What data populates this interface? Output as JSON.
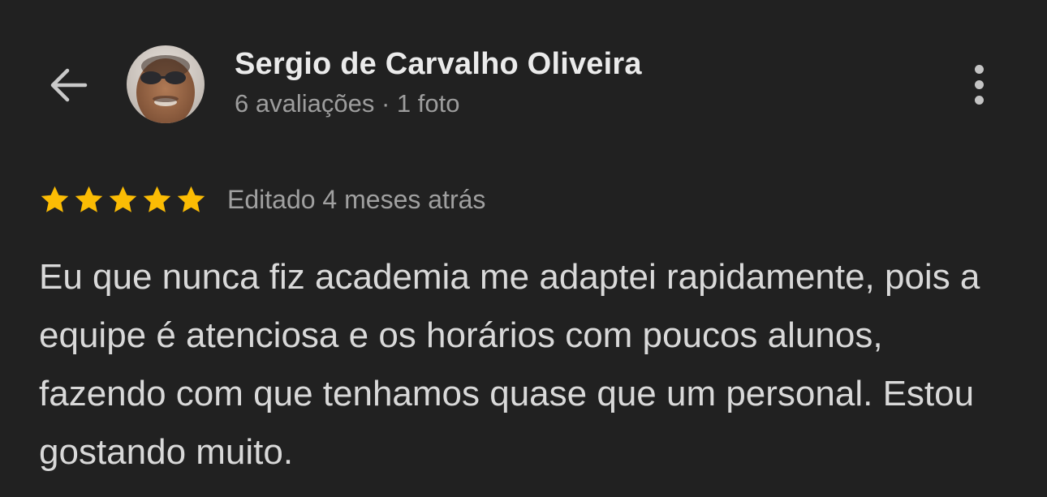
{
  "header": {
    "back_icon": "arrow-left-icon",
    "more_icon": "more-vert-icon"
  },
  "reviewer": {
    "name": "Sergio de Carvalho Oliveira",
    "meta": "6 avaliações · 1 foto",
    "avatar_icon": "avatar-photo"
  },
  "review": {
    "rating": 5,
    "max_rating": 5,
    "star_color": "#fbbc04",
    "edited": "Editado 4 meses atrás",
    "text": "Eu que nunca fiz academia me adaptei rapidamente, pois a equipe é atenciosa e os horários com poucos alunos, fazendo com que tenhamos quase que um personal. Estou gostando muito."
  }
}
